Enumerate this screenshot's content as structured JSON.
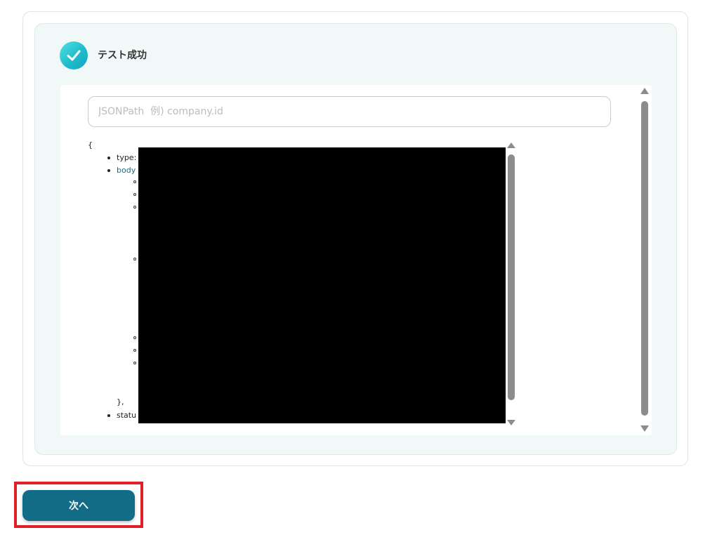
{
  "result": {
    "status_title": "テスト成功",
    "status_icon": "check-icon",
    "accent_color": "#1db9cb"
  },
  "search": {
    "placeholder": "JSONPath  例) company.id",
    "value": ""
  },
  "json_tree": {
    "open_brace": "{",
    "keys": {
      "type": "type:",
      "body": "body",
      "status": "statu"
    },
    "close_body": "},"
  },
  "footer": {
    "next_label": "次へ",
    "button_color": "#136c86",
    "highlight_color": "#e11f26"
  }
}
